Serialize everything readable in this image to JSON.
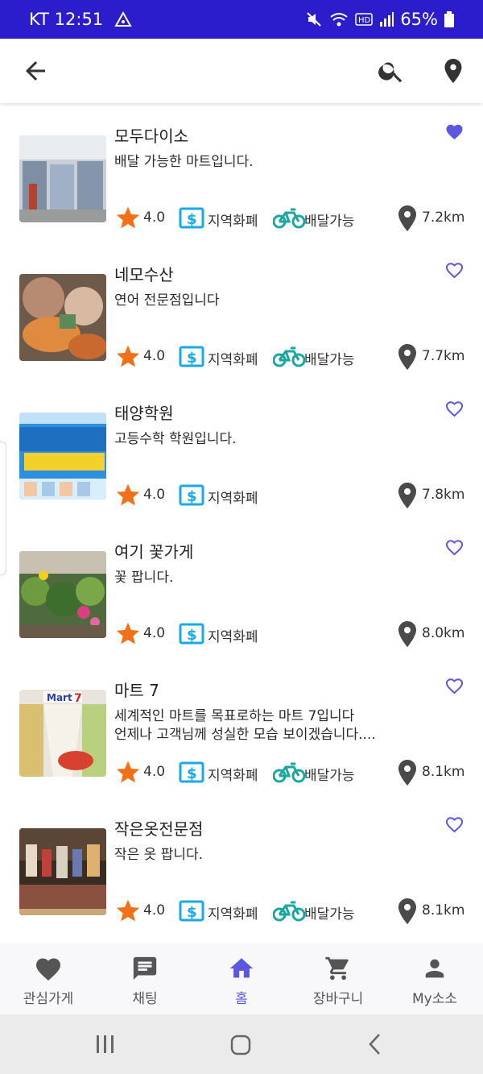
{
  "status": {
    "carrier_time": "KT 12:51",
    "battery": "65%"
  },
  "colors": {
    "status_bar": "#2b1dcc",
    "accent": "#5b57e0",
    "star": "#f27118",
    "currency": "#1aa8e8",
    "bike": "#18a8a0",
    "pin": "#4a4a4a"
  },
  "app_bar": {
    "icons": [
      "arrow-back-icon",
      "search-icon",
      "location-pin-icon"
    ]
  },
  "stores": [
    {
      "name": "모두다이소",
      "desc": "배달 가능한 마트입니다.",
      "rating": "4.0",
      "currency": "지역화폐",
      "delivery": "배달가능",
      "distance": "7.2km",
      "favorite": true
    },
    {
      "name": "네모수산",
      "desc": "연어 전문점입니다",
      "rating": "4.0",
      "currency": "지역화폐",
      "delivery": "배달가능",
      "distance": "7.7km",
      "favorite": false
    },
    {
      "name": "태양학원",
      "desc": "고등수학 학원입니다.",
      "rating": "4.0",
      "currency": "지역화폐",
      "delivery": "",
      "distance": "7.8km",
      "favorite": false
    },
    {
      "name": "여기 꽃가게",
      "desc": "꽃 팝니다.",
      "rating": "4.0",
      "currency": "지역화폐",
      "delivery": "",
      "distance": "8.0km",
      "favorite": false
    },
    {
      "name": "마트 7",
      "desc": "세계적인 마트를 목표로하는 마트 7입니다\n언제나 고객님께 성실한 모습 보이겠습니다....",
      "rating": "4.0",
      "currency": "지역화폐",
      "delivery": "배달가능",
      "distance": "8.1km",
      "favorite": false
    },
    {
      "name": "작은옷전문점",
      "desc": "작은 옷 팝니다.",
      "rating": "4.0",
      "currency": "지역화폐",
      "delivery": "배달가능",
      "distance": "8.1km",
      "favorite": false
    }
  ],
  "bottom_nav": [
    {
      "label": "관심가게",
      "icon": "heart-icon",
      "active": false
    },
    {
      "label": "채팅",
      "icon": "chat-icon",
      "active": false
    },
    {
      "label": "홈",
      "icon": "home-icon",
      "active": true
    },
    {
      "label": "장바구니",
      "icon": "cart-icon",
      "active": false
    },
    {
      "label": "My소소",
      "icon": "person-icon",
      "active": false
    }
  ]
}
